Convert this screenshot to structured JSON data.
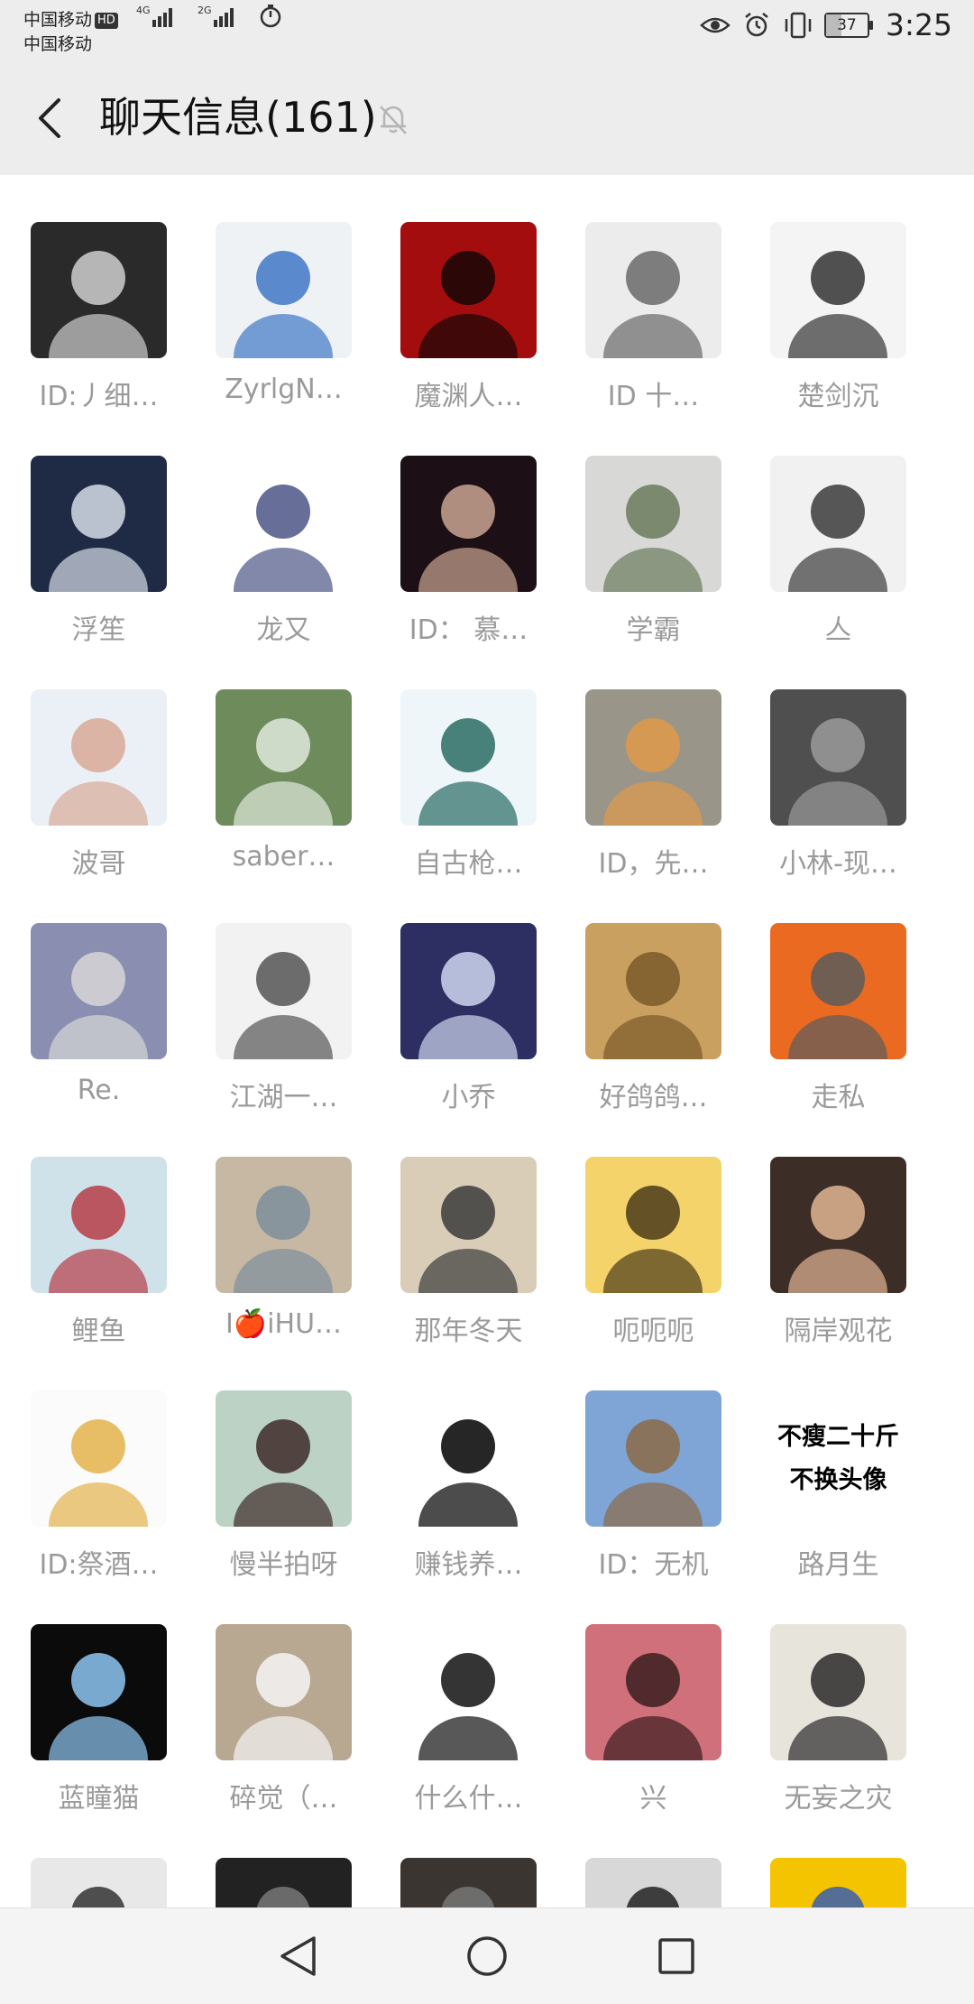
{
  "status_bar": {
    "carrier1": "中国移动",
    "hd_badge": "HD",
    "carrier2": "中国移动",
    "net1": "4G",
    "net2": "2G",
    "battery": "37",
    "battery_level": 0.37,
    "time": "3:25",
    "icons": [
      "eye-icon",
      "alarm-icon",
      "vibrate-icon",
      "battery-icon"
    ]
  },
  "header": {
    "title": "聊天信息(161)",
    "back_icon": "chevron-left-icon",
    "mute_icon": "bell-off-icon"
  },
  "members": [
    {
      "name": "ID:丿细…",
      "color": "#2a2a2a",
      "accent": "#cfcfcf"
    },
    {
      "name": "ZyrlgN…",
      "color": "#eef2f5",
      "accent": "#3f78c6"
    },
    {
      "name": "魔渊人…",
      "color": "#a30d0d",
      "accent": "#160707"
    },
    {
      "name": "ID 十…",
      "color": "#ececec",
      "accent": "#6a6a6a"
    },
    {
      "name": "楚剑沉",
      "color": "#f4f4f4",
      "accent": "#333333"
    },
    {
      "name": "浮笙",
      "color": "#1f2a44",
      "accent": "#d7dde8"
    },
    {
      "name": "龙又",
      "color": "#ffffff",
      "accent": "#4c5686"
    },
    {
      "name": "ID： 慕…",
      "color": "#1c1016",
      "accent": "#caa592"
    },
    {
      "name": "学霸",
      "color": "#d8d9d6",
      "accent": "#6b7a5c"
    },
    {
      "name": "亼",
      "color": "#f1f1f1",
      "accent": "#3b3b3b"
    },
    {
      "name": "波哥",
      "color": "#eaf0f6",
      "accent": "#d9a997"
    },
    {
      "name": "saber…",
      "color": "#6e8b5c",
      "accent": "#dfe9dc"
    },
    {
      "name": "自古枪…",
      "color": "#eef6fa",
      "accent": "#2a6b63"
    },
    {
      "name": "ID，先…",
      "color": "#9a9589",
      "accent": "#e09a4a"
    },
    {
      "name": "小林-现…",
      "color": "#4f4f4f",
      "accent": "#9a9a9a"
    },
    {
      "name": "Re.",
      "color": "#8a8fb2",
      "accent": "#d6d6d6"
    },
    {
      "name": "江湖一…",
      "color": "#f2f2f2",
      "accent": "#555555"
    },
    {
      "name": "小乔",
      "color": "#2d2f63",
      "accent": "#cfd6ee"
    },
    {
      "name": "好鸽鸽…",
      "color": "#c9a060",
      "accent": "#7a5a2a"
    },
    {
      "name": "走私",
      "color": "#ea6a22",
      "accent": "#5c5c5c"
    },
    {
      "name": "鲤鱼",
      "color": "#cfe2ea",
      "accent": "#b53d47"
    },
    {
      "name": "I🍎iHU…",
      "color": "#c7b8a4",
      "accent": "#7d8e9c"
    },
    {
      "name": "那年冬天",
      "color": "#d9cdb8",
      "accent": "#3b3b3b"
    },
    {
      "name": "呃呃呃",
      "color": "#f5d36b",
      "accent": "#4a3b1a"
    },
    {
      "name": "隔岸观花",
      "color": "#3c2e26",
      "accent": "#e0b594"
    },
    {
      "name": "ID:祭酒…",
      "color": "#fbfbfb",
      "accent": "#e3b24a"
    },
    {
      "name": "慢半拍呀",
      "color": "#bcd2c5",
      "accent": "#3e2b28"
    },
    {
      "name": "赚钱养…",
      "color": "#ffffff",
      "accent": "#000000"
    },
    {
      "name": "ID：无机",
      "color": "#7ea5d6",
      "accent": "#8b6a47"
    },
    {
      "name": "路月生",
      "color": "#ffffff",
      "accent": "#000000",
      "text_lines": [
        "不瘦二十斤",
        "不换头像"
      ]
    },
    {
      "name": "蓝瞳猫",
      "color": "#0b0b0b",
      "accent": "#8ec6f2"
    },
    {
      "name": "碎觉（…",
      "color": "#b8a891",
      "accent": "#f4f4f4"
    },
    {
      "name": "什么什…",
      "color": "#ffffff",
      "accent": "#111111"
    },
    {
      "name": "兴",
      "color": "#d0707a",
      "accent": "#3a1d1f"
    },
    {
      "name": "无妄之灾",
      "color": "#e7e4dc",
      "accent": "#2a2a2a"
    },
    {
      "name": "",
      "color": "#e8e8e8",
      "accent": "#333333"
    },
    {
      "name": "",
      "color": "#222222",
      "accent": "#777777"
    },
    {
      "name": "",
      "color": "#3a3530",
      "accent": "#777777"
    },
    {
      "name": "",
      "color": "#d8d8d8",
      "accent": "#222222"
    },
    {
      "name": "",
      "color": "#f5c400",
      "accent": "#3a5fae"
    }
  ],
  "nav": {
    "back": "triangle-back-icon",
    "home": "circle-home-icon",
    "recent": "square-recent-icon"
  }
}
